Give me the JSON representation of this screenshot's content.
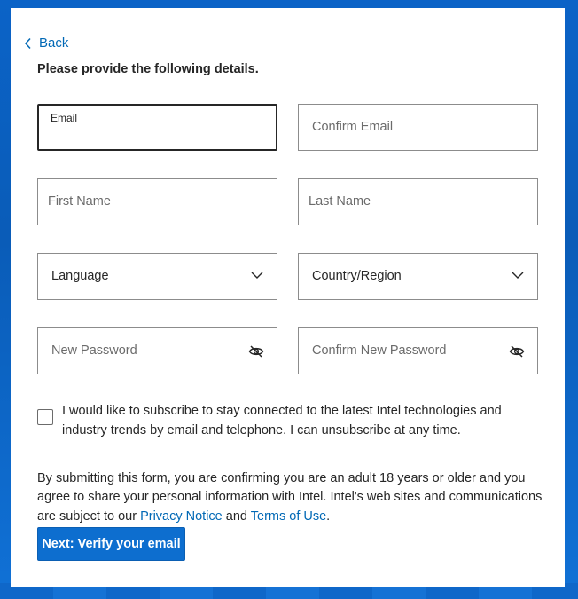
{
  "nav": {
    "back_label": "Back",
    "back_icon": "chevron-left-icon"
  },
  "form": {
    "heading": "Please provide the following details.",
    "email": {
      "label": "Email",
      "value": ""
    },
    "confirm_email": {
      "placeholder": "Confirm Email"
    },
    "first_name": {
      "placeholder": "First Name"
    },
    "last_name": {
      "placeholder": "Last Name"
    },
    "language": {
      "selected": "Language",
      "icon": "chevron-down-icon"
    },
    "country": {
      "selected": "Country/Region",
      "icon": "chevron-down-icon"
    },
    "new_password": {
      "placeholder": "New Password",
      "icon": "eye-slash-icon"
    },
    "confirm_password": {
      "placeholder": "Confirm New Password",
      "icon": "eye-slash-icon"
    },
    "subscribe": {
      "checked": false,
      "label": "I would like to subscribe to stay connected to the latest Intel technologies and industry trends by email and telephone. I can unsubscribe at any time."
    },
    "legal": {
      "text_before": "By submitting this form, you are confirming you are an adult 18 years or older and you agree to share your personal information with Intel. Intel's web sites and communications are subject to our ",
      "privacy_link": "Privacy Notice",
      "and": " and ",
      "terms_link": "Terms of Use",
      "period": "."
    },
    "submit_label": "Next: Verify your email"
  },
  "colors": {
    "link": "#0068b5",
    "primary_button": "#0d6ecf",
    "background": "#0a5fc0",
    "text": "#262626"
  }
}
